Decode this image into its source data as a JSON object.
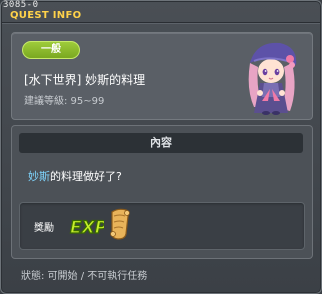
{
  "window": {
    "code": "3085-0",
    "title": "QUEST INFO"
  },
  "quest": {
    "badge": "一般",
    "name": "[水下世界] 妙斯的料理",
    "level": "建議等級: 95~99",
    "npc_icon": "npc-portrait-purple-hat-girl"
  },
  "content": {
    "header": "內容",
    "npc_name": "妙斯",
    "text_rest": "的料理做好了?",
    "reward_label": "獎勵",
    "reward_icons": [
      "exp-icon",
      "scroll-icon"
    ]
  },
  "status": "狀態: 可開始 / 不可執行任務",
  "colors": {
    "title": "#ffd24a",
    "badge_green": "#8cbf2c",
    "npc_name": "#7fd6ff"
  }
}
